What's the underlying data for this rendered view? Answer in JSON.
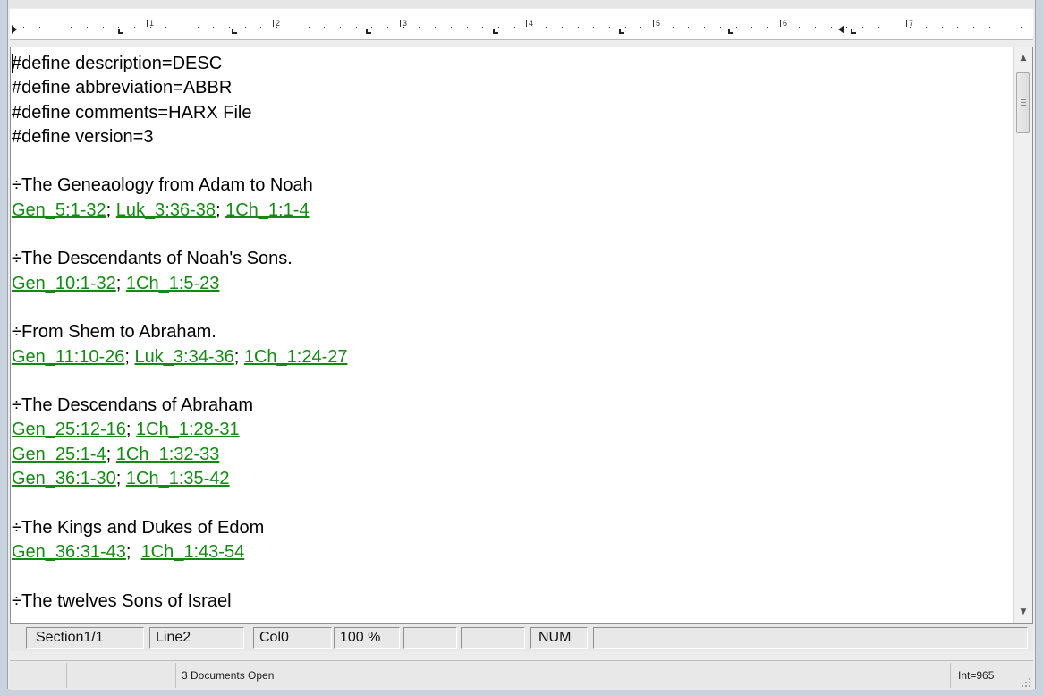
{
  "editor": {
    "lines": [
      {
        "type": "text",
        "text": "#define description=DESC"
      },
      {
        "type": "text",
        "text": "#define abbreviation=ABBR"
      },
      {
        "type": "text",
        "text": "#define comments=HARX File"
      },
      {
        "type": "text",
        "text": "#define version=3"
      },
      {
        "type": "blank"
      },
      {
        "type": "text",
        "text": "÷The Geneaology from Adam to Noah"
      },
      {
        "type": "refs",
        "refs": [
          "Gen_5:1-32",
          "Luk_3:36-38",
          "1Ch_1:1-4"
        ],
        "sep": "; "
      },
      {
        "type": "blank"
      },
      {
        "type": "text",
        "text": "÷The Descendants of Noah's Sons."
      },
      {
        "type": "refs",
        "refs": [
          "Gen_10:1-32",
          "1Ch_1:5-23"
        ],
        "sep": "; "
      },
      {
        "type": "blank"
      },
      {
        "type": "text",
        "text": "÷From Shem to Abraham."
      },
      {
        "type": "refs",
        "refs": [
          "Gen_11:10-26",
          "Luk_3:34-36",
          "1Ch_1:24-27"
        ],
        "sep": "; "
      },
      {
        "type": "blank"
      },
      {
        "type": "text",
        "text": "÷The Descendans of Abraham"
      },
      {
        "type": "refs",
        "refs": [
          "Gen_25:12-16",
          "1Ch_1:28-31"
        ],
        "sep": "; "
      },
      {
        "type": "refs",
        "refs": [
          "Gen_25:1-4",
          "1Ch_1:32-33"
        ],
        "sep": "; "
      },
      {
        "type": "refs",
        "refs": [
          "Gen_36:1-30",
          "1Ch_1:35-42"
        ],
        "sep": "; "
      },
      {
        "type": "blank"
      },
      {
        "type": "text",
        "text": "÷The Kings and Dukes of Edom"
      },
      {
        "type": "refs",
        "refs": [
          "Gen_36:31-43",
          "1Ch_1:43-54"
        ],
        "sep": ";  "
      },
      {
        "type": "blank"
      },
      {
        "type": "text",
        "text": "÷The twelves Sons of Israel"
      }
    ],
    "link_color": "#148a14"
  },
  "ruler": {
    "numbers": [
      "1",
      "2",
      "3",
      "4",
      "5",
      "6",
      "7"
    ]
  },
  "status": {
    "section": "Section1/1",
    "line": "Line2",
    "col": "Col0",
    "zoom": "100 %",
    "num": "NUM",
    "documents": "3 Documents Open",
    "int": "Int=965"
  },
  "scrollbar": {
    "up_icon": "triangle-up",
    "down_icon": "triangle-down",
    "position": 0.0
  }
}
